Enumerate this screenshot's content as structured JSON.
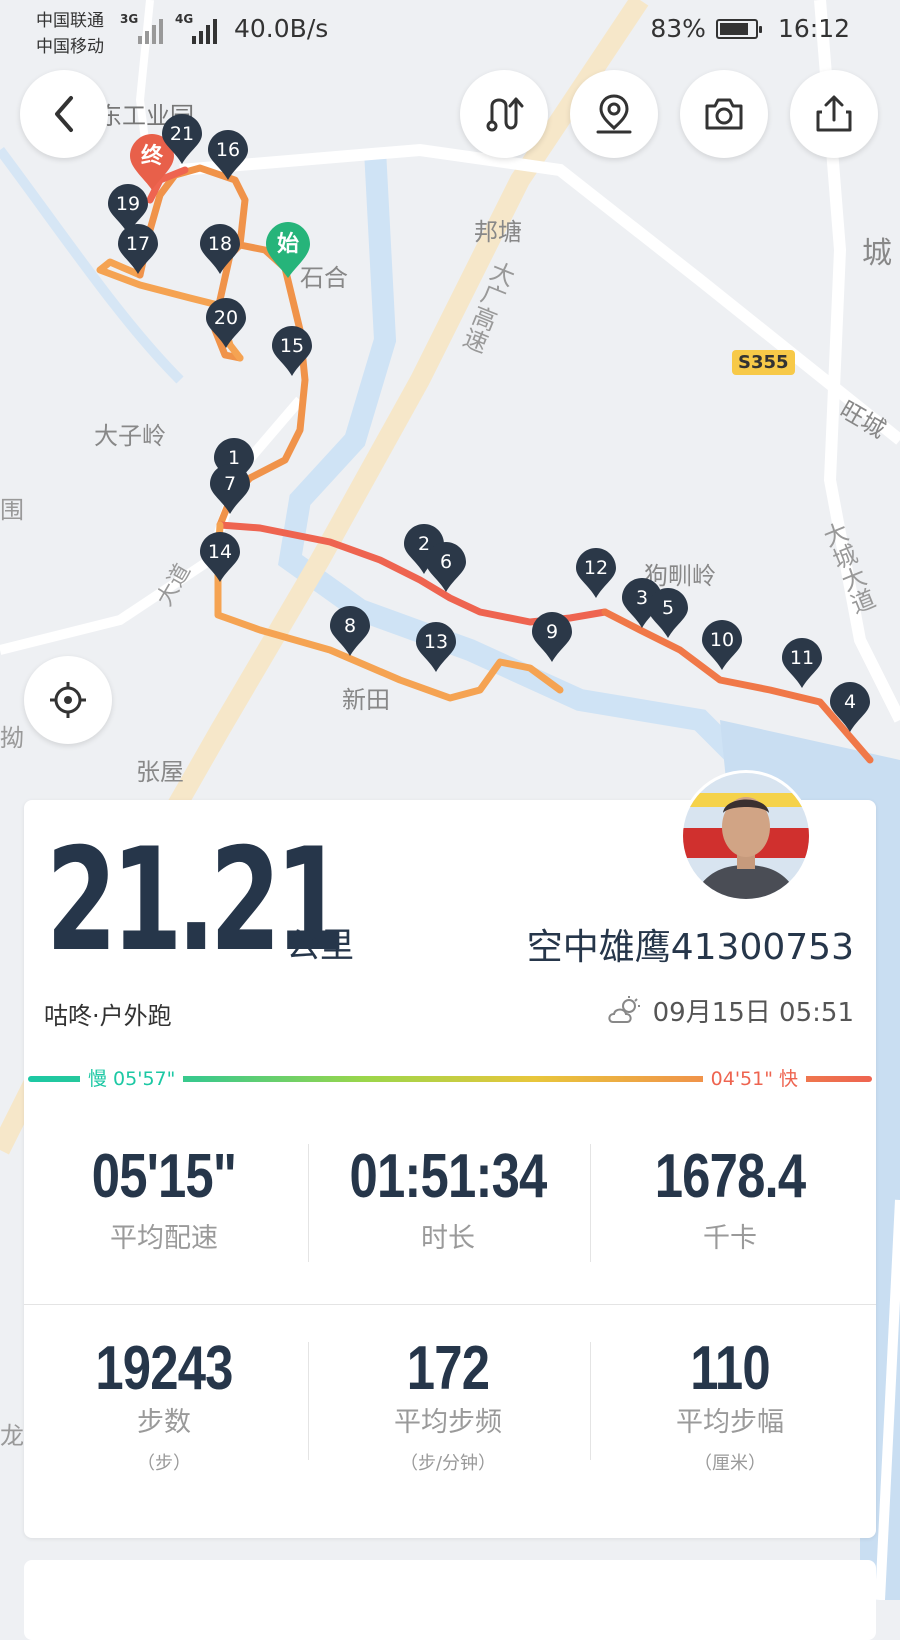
{
  "status_bar": {
    "carrier1": "中国联通",
    "carrier2": "中国移动",
    "net1": "3G",
    "net2": "4G",
    "speed": "40.0B/s",
    "battery": "83%",
    "battery_level": 0.83,
    "time": "16:12"
  },
  "map": {
    "labels": [
      "东工业园",
      "邦塘",
      "石合",
      "城",
      "大子岭",
      "围",
      "狗甽岭",
      "新田",
      "张屋",
      "旺城",
      "拗",
      "龙",
      "大道",
      "大广高速",
      "大城大道"
    ],
    "road_badge": "S355",
    "start_label": "始",
    "end_label": "终",
    "km_markers": [
      "1",
      "2",
      "3",
      "4",
      "5",
      "6",
      "7",
      "8",
      "9",
      "10",
      "11",
      "12",
      "13",
      "14",
      "15",
      "16",
      "17",
      "18",
      "19",
      "20",
      "21"
    ]
  },
  "toolbar": {
    "back_icon": "back-arrow-icon",
    "route_icon": "route-icon",
    "location_pin_icon": "location-pin-icon",
    "camera_icon": "camera-icon",
    "share_icon": "share-icon",
    "locate_icon": "crosshair-icon"
  },
  "summary": {
    "distance": "21.21",
    "distance_unit": "公里",
    "username": "空中雄鹰41300753",
    "sport_type": "咕咚·户外跑",
    "datetime": "09月15日 05:51",
    "weather_icon": "partly-cloudy-icon"
  },
  "pace_scale": {
    "slow_label": "慢 05'57\"",
    "fast_label": "04'51\" 快",
    "slow_color": "#1cc8a4",
    "fast_color": "#ee6450"
  },
  "stats": [
    {
      "value": "05'15\"",
      "label": "平均配速",
      "sub": ""
    },
    {
      "value": "01:51:34",
      "label": "时长",
      "sub": ""
    },
    {
      "value": "1678.4",
      "label": "千卡",
      "sub": ""
    },
    {
      "value": "19243",
      "label": "步数",
      "sub": "（步）"
    },
    {
      "value": "172",
      "label": "平均步频",
      "sub": "（步/分钟）"
    },
    {
      "value": "110",
      "label": "平均步幅",
      "sub": "（厘米）"
    }
  ],
  "colors": {
    "accent_dark": "#26364a",
    "route_orange": "#f0934a",
    "route_red": "#ee6450",
    "start_green": "#26b47a",
    "end_red": "#e8604a"
  }
}
